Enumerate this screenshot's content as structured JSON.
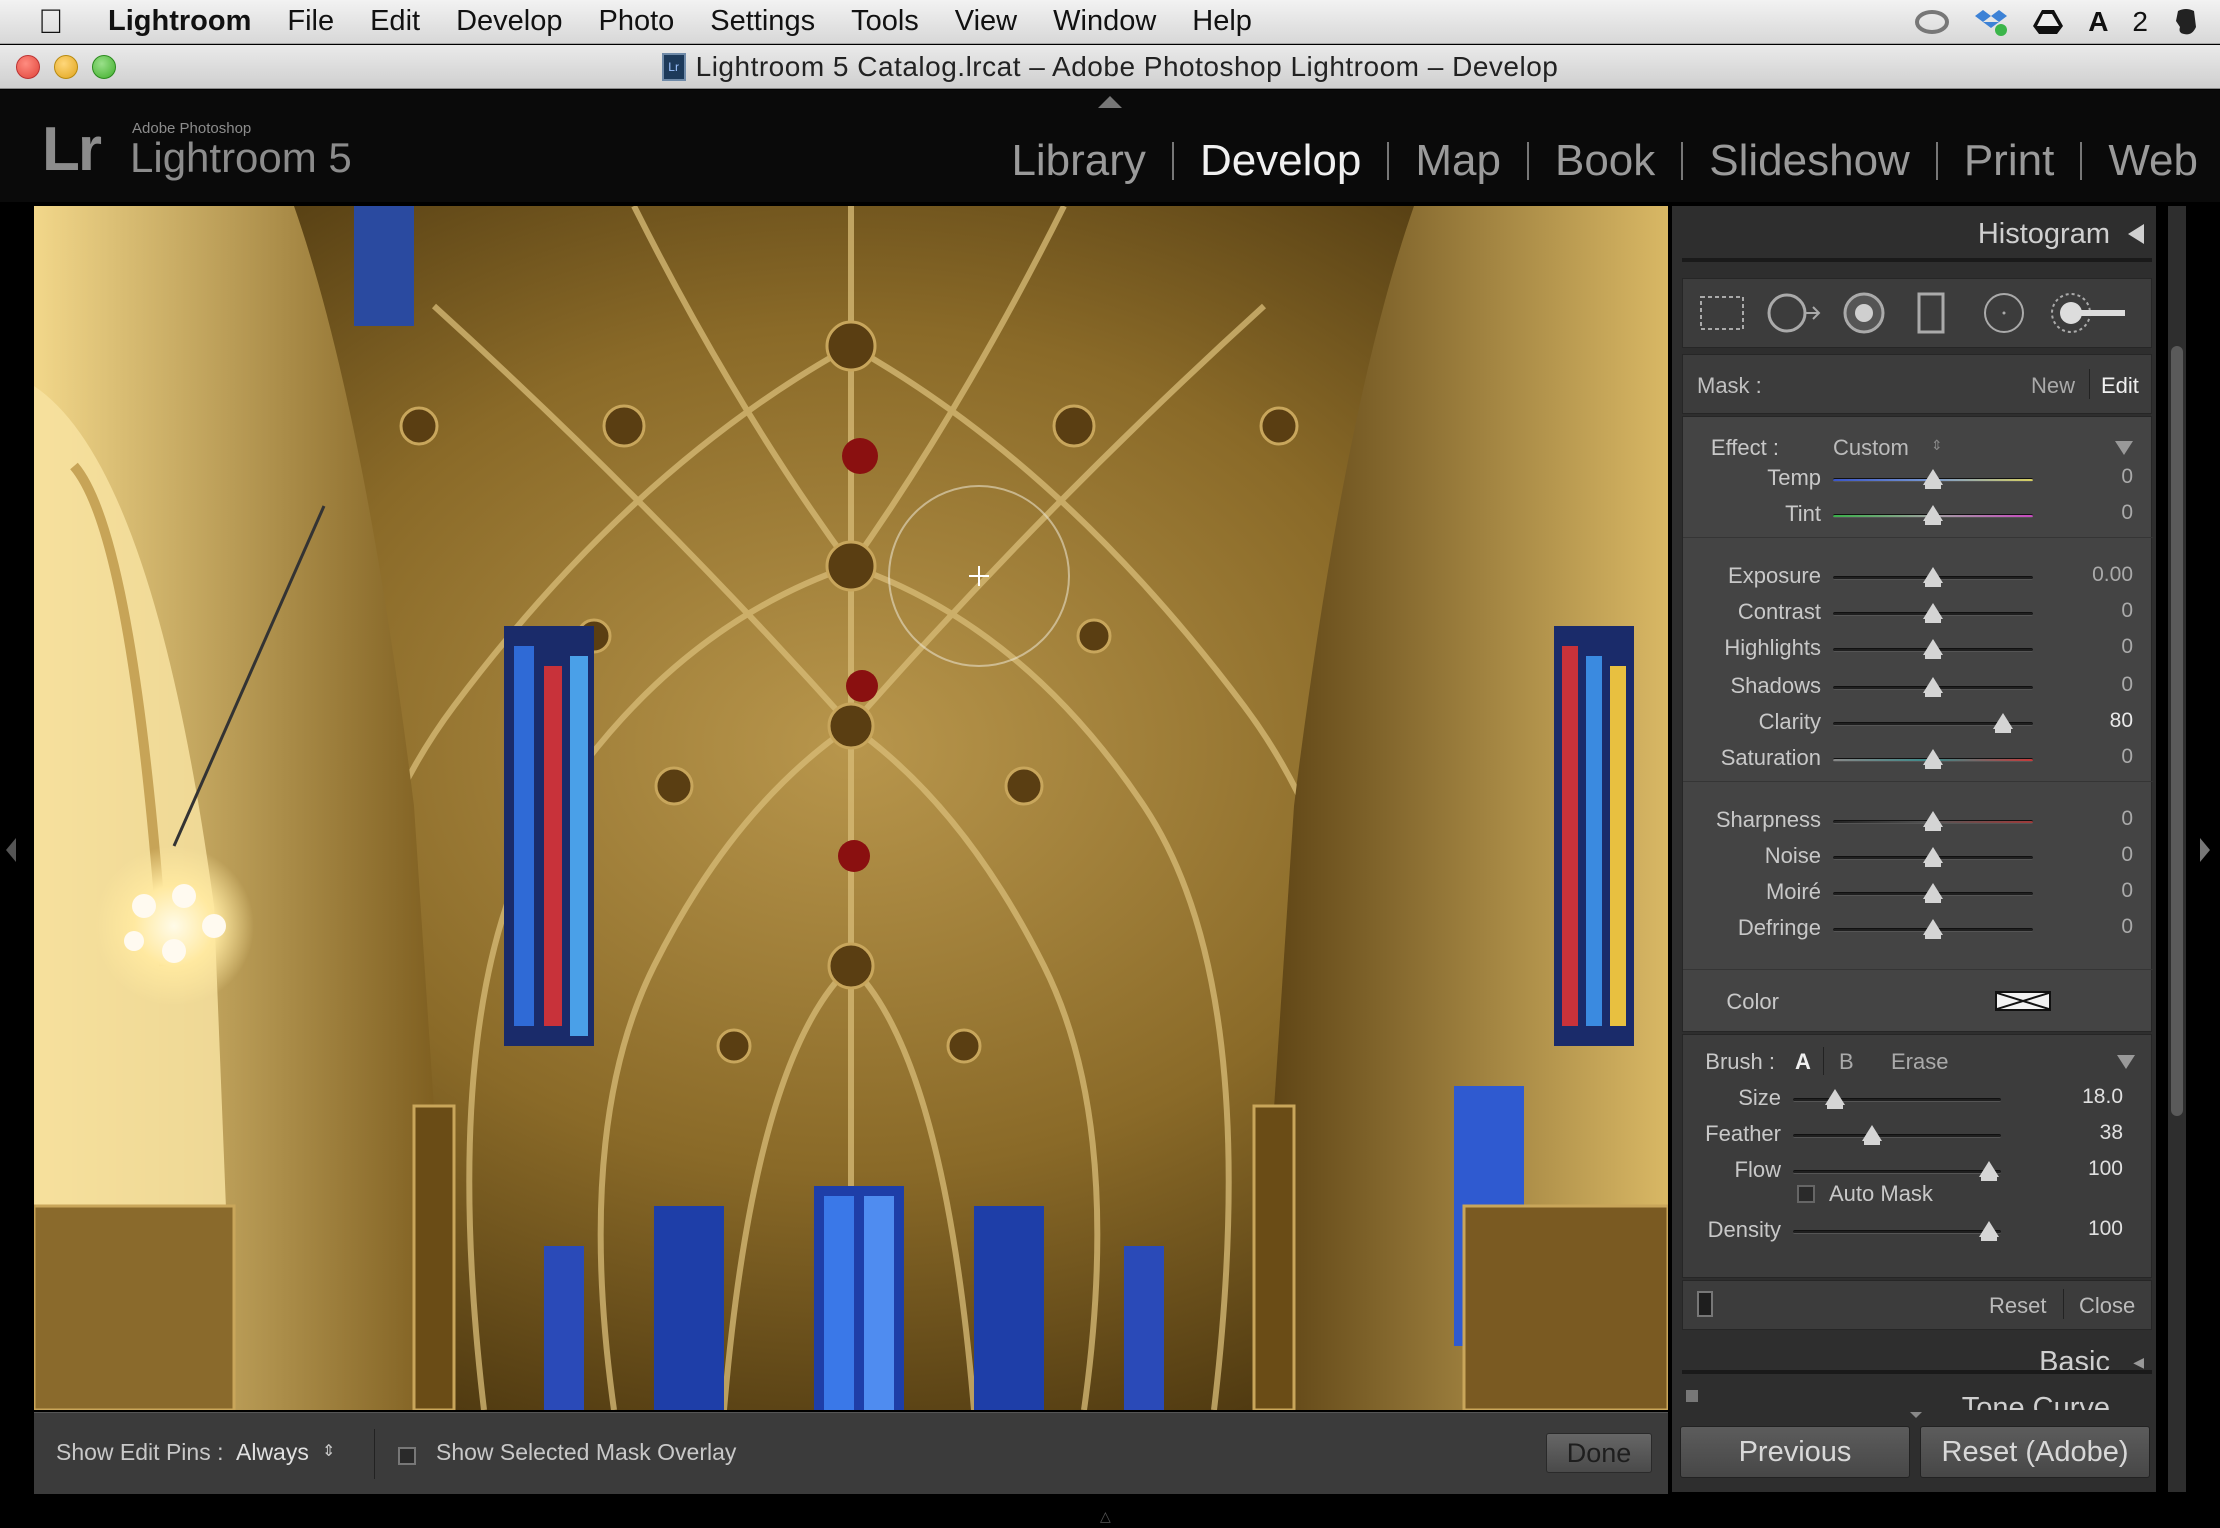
{
  "menubar": {
    "items": [
      "Lightroom",
      "File",
      "Edit",
      "Develop",
      "Photo",
      "Settings",
      "Tools",
      "View",
      "Window",
      "Help"
    ],
    "tray_badge": "2"
  },
  "window": {
    "title": "Lightroom 5 Catalog.lrcat – Adobe Photoshop Lightroom – Develop"
  },
  "brand": {
    "logo": "Lr",
    "small": "Adobe Photoshop",
    "name": "Lightroom 5"
  },
  "modules": [
    "Library",
    "Develop",
    "Map",
    "Book",
    "Slideshow",
    "Print",
    "Web"
  ],
  "active_module": "Develop",
  "toolbar": {
    "show_edit_pins_label": "Show Edit Pins :",
    "show_edit_pins_value": "Always",
    "mask_overlay_label": "Show Selected Mask Overlay",
    "done_label": "Done"
  },
  "panel": {
    "histogram_label": "Histogram",
    "tool_icons": [
      "crop-overlay-icon",
      "spot-removal-icon",
      "red-eye-icon",
      "graduated-filter-icon",
      "radial-filter-icon",
      "adjustment-brush-icon"
    ],
    "mask": {
      "label": "Mask :",
      "new": "New",
      "edit": "Edit"
    },
    "effect": {
      "label": "Effect :",
      "preset": "Custom"
    },
    "sliders": [
      {
        "label": "Temp",
        "value": "0",
        "pos": 0.5,
        "group": 1
      },
      {
        "label": "Tint",
        "value": "0",
        "pos": 0.5,
        "group": 1
      },
      {
        "label": "Exposure",
        "value": "0.00",
        "pos": 0.5,
        "group": 2
      },
      {
        "label": "Contrast",
        "value": "0",
        "pos": 0.5,
        "group": 2
      },
      {
        "label": "Highlights",
        "value": "0",
        "pos": 0.5,
        "group": 2
      },
      {
        "label": "Shadows",
        "value": "0",
        "pos": 0.5,
        "group": 2
      },
      {
        "label": "Clarity",
        "value": "80",
        "pos": 0.85,
        "group": 2
      },
      {
        "label": "Saturation",
        "value": "0",
        "pos": 0.5,
        "group": 2
      },
      {
        "label": "Sharpness",
        "value": "0",
        "pos": 0.5,
        "group": 3
      },
      {
        "label": "Noise",
        "value": "0",
        "pos": 0.5,
        "group": 3
      },
      {
        "label": "Moiré",
        "value": "0",
        "pos": 0.5,
        "group": 3
      },
      {
        "label": "Defringe",
        "value": "0",
        "pos": 0.5,
        "group": 3
      }
    ],
    "color_label": "Color",
    "brush": {
      "label": "Brush :",
      "a": "A",
      "b": "B",
      "erase": "Erase",
      "sliders": [
        {
          "label": "Size",
          "value": "18.0",
          "pos": 0.2
        },
        {
          "label": "Feather",
          "value": "38",
          "pos": 0.38
        },
        {
          "label": "Flow",
          "value": "100",
          "pos": 0.94
        }
      ],
      "auto_mask_label": "Auto Mask",
      "density": {
        "label": "Density",
        "value": "100",
        "pos": 0.94
      }
    },
    "footer": {
      "reset": "Reset",
      "close": "Close"
    },
    "basic_label": "Basic",
    "tone_curve_label": "Tone Curve",
    "previous_label": "Previous",
    "reset_adobe_label": "Reset (Adobe)"
  }
}
